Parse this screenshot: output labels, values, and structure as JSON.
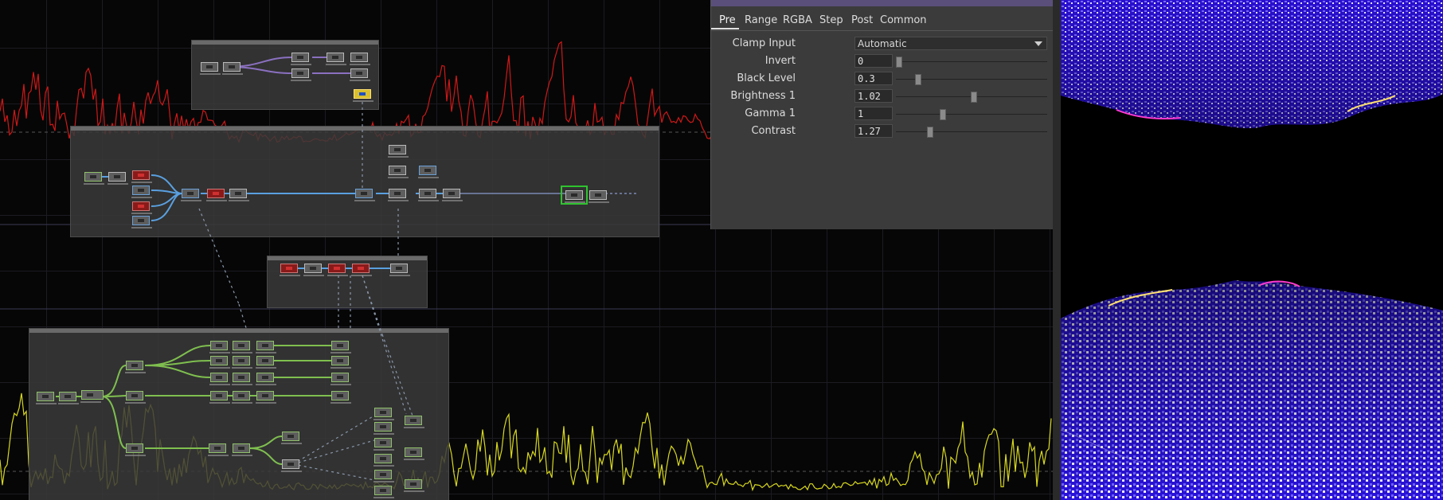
{
  "params": {
    "tabs": [
      "Pre",
      "Range",
      "RGBA",
      "Step",
      "Post",
      "Common"
    ],
    "active_tab": "Pre",
    "clamp_input": {
      "label": "Clamp Input",
      "value": "Automatic"
    },
    "rows": [
      {
        "label": "Invert",
        "value": "0",
        "slider_fraction": 0.0
      },
      {
        "label": "Black Level",
        "value": "0.3",
        "slider_fraction": 0.13
      },
      {
        "label": "Brightness 1",
        "value": "1.02",
        "slider_fraction": 0.51
      },
      {
        "label": "Gamma 1",
        "value": "1",
        "slider_fraction": 0.3
      },
      {
        "label": "Contrast",
        "value": "1.27",
        "slider_fraction": 0.21
      }
    ]
  },
  "colors": {
    "signal_top": "#d01818",
    "signal_bottom": "#d8d820",
    "link_blue": "#5aa0e0",
    "link_green": "#7fbf4f",
    "link_purple": "#8a70c0",
    "panel_accent": "#5a4f7a",
    "selected_node": "#2fc42f"
  },
  "icons": [
    "node-tile-icon",
    "chevron-down-icon",
    "slider-thumb-icon"
  ]
}
